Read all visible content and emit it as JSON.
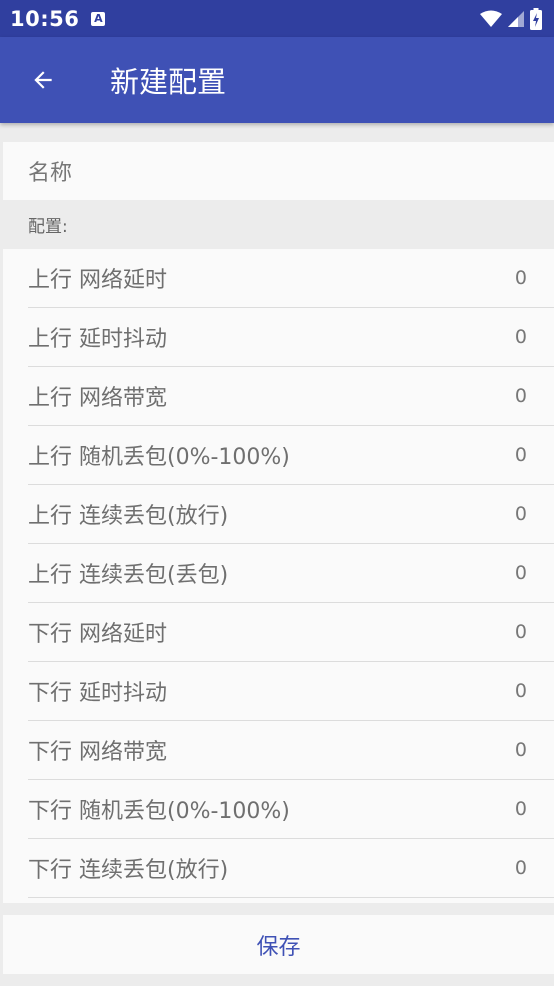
{
  "status_bar": {
    "time": "10:56",
    "app_icon_letter": "A"
  },
  "app_bar": {
    "title": "新建配置"
  },
  "form": {
    "name_label": "名称",
    "section_label": "配置:",
    "rows": [
      {
        "label": "上行 网络延时",
        "value": "0"
      },
      {
        "label": "上行 延时抖动",
        "value": "0"
      },
      {
        "label": "上行 网络带宽",
        "value": "0"
      },
      {
        "label": "上行 随机丢包(0%-100%)",
        "value": "0"
      },
      {
        "label": "上行 连续丢包(放行)",
        "value": "0"
      },
      {
        "label": "上行 连续丢包(丢包)",
        "value": "0"
      },
      {
        "label": "下行 网络延时",
        "value": "0"
      },
      {
        "label": "下行 延时抖动",
        "value": "0"
      },
      {
        "label": "下行 网络带宽",
        "value": "0"
      },
      {
        "label": "下行 随机丢包(0%-100%)",
        "value": "0"
      },
      {
        "label": "下行 连续丢包(放行)",
        "value": "0"
      }
    ]
  },
  "save_label": "保存",
  "colors": {
    "primary": "#3f51b5",
    "primary_dark": "#303f9f"
  }
}
